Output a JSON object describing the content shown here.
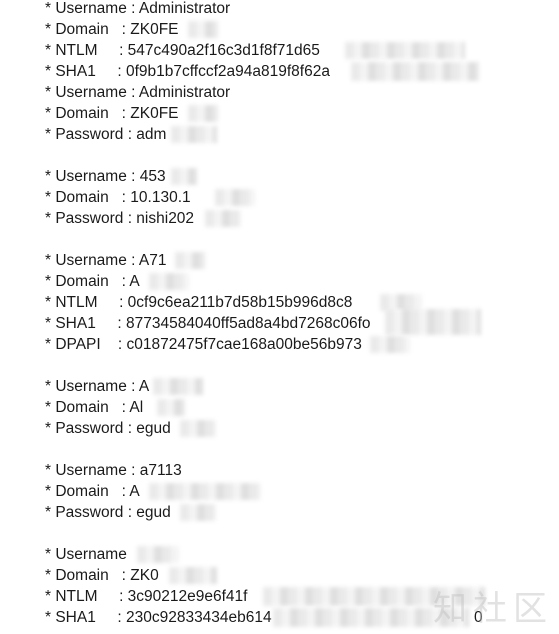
{
  "colors": {
    "background": "#ffffff",
    "text": "#1a1a1a",
    "redaction": "#e6e6e6",
    "watermark": "#bebebe"
  },
  "credentials": {
    "r1": "* Username : Administrator",
    "r2": "* Domain   : ZK0FE",
    "r3": "* NTLM     : 547c490a2f16c3d1f8f71d65",
    "r4": "* SHA1     : 0f9b1b7cffccf2a94a819f8f62a",
    "r5": "* Username : Administrator",
    "r6": "* Domain   : ZK0FE",
    "r7": "* Password : adm",
    "r8": "* Username : 453",
    "r9": "* Domain   : 10.130.1",
    "r10": "* Password : nishi202",
    "r11": "* Username : A71",
    "r12": "* Domain   : A",
    "r13": "* NTLM     : 0cf9c6ea211b7d58b15b996d8c8",
    "r14": "* SHA1     : 87734584040ff5ad8a4bd7268c06fo",
    "r15": "* DPAPI    : c01872475f7cae168a00be56b973",
    "r16": "* Username : A",
    "r17": "* Domain   : Al",
    "r18": "* Password : egud",
    "r19": "* Username : a7113",
    "r20": "* Domain   : A",
    "r21": "* Password : egud",
    "r22": "* Username",
    "r23": "* Domain   : ZK0",
    "r24": "* NTLM     : 3c90212e9e6f41f",
    "r25": "* SHA1     : 230c92833434eb614",
    "r25_tail": "0"
  },
  "watermark": {
    "text": "知社区"
  }
}
